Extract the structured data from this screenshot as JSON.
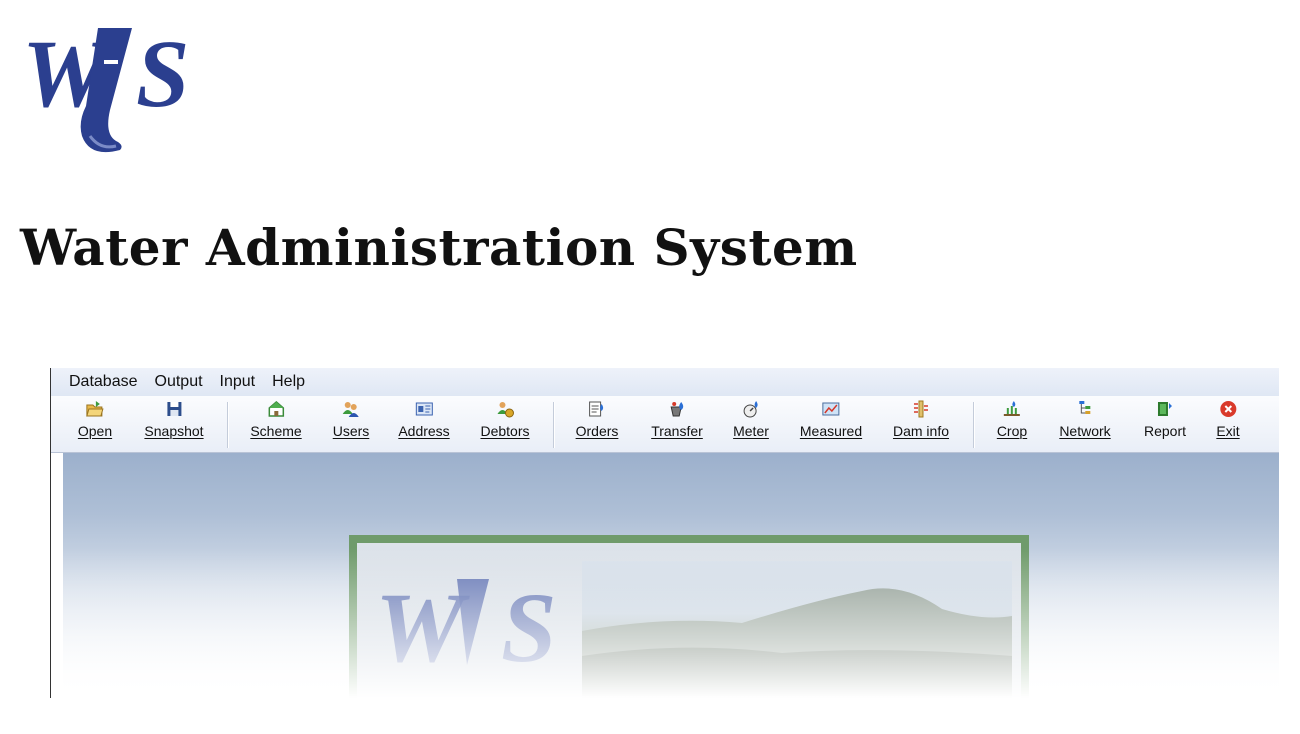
{
  "title": "Water Administration System",
  "logo_text": "WAS",
  "menu": [
    "Database",
    "Output",
    "Input",
    "Help"
  ],
  "toolbar": [
    {
      "label": "Open",
      "icon": "folder-open-icon"
    },
    {
      "label": "Snapshot",
      "icon": "floppy-disk-icon"
    },
    {
      "label": "Scheme",
      "icon": "house-icon"
    },
    {
      "label": "Users",
      "icon": "users-icon"
    },
    {
      "label": "Address",
      "icon": "address-card-icon"
    },
    {
      "label": "Debtors",
      "icon": "money-bag-icon"
    },
    {
      "label": "Orders",
      "icon": "order-form-icon"
    },
    {
      "label": "Transfer",
      "icon": "bucket-drop-icon"
    },
    {
      "label": "Meter",
      "icon": "meter-icon"
    },
    {
      "label": "Measured",
      "icon": "chart-icon"
    },
    {
      "label": "Dam info",
      "icon": "dam-level-icon"
    },
    {
      "label": "Crop",
      "icon": "crop-plant-icon"
    },
    {
      "label": "Network",
      "icon": "network-tree-icon"
    },
    {
      "label": "Report",
      "icon": "report-icon"
    },
    {
      "label": "Exit",
      "icon": "exit-icon"
    }
  ],
  "colors": {
    "logo": "#2b3f8f",
    "menubar": "#dfe7f4",
    "workspace": "#9cb0cc",
    "splash_frame": "#6f9b6b",
    "exit": "#d93a2b"
  }
}
